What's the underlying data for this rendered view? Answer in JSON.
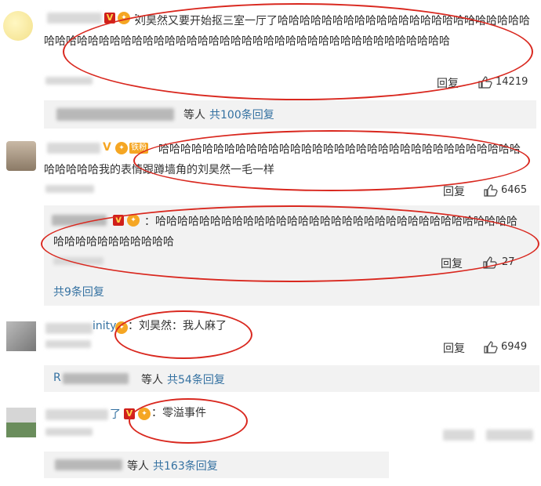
{
  "c1": {
    "colon": "：",
    "text": "刘昊然又要开始抠三室一厅了哈哈哈哈哈哈哈哈哈哈哈哈哈哈哈哈哈哈哈哈哈哈哈哈哈哈哈哈哈哈哈哈哈哈哈哈哈哈哈哈哈哈哈哈哈哈哈哈哈哈哈哈哈哈哈哈哈哈哈哈",
    "reply_label": "回复",
    "likes": "14219",
    "sub_prefix": "等人",
    "sub_count": "共100条回复"
  },
  "c2": {
    "fan_tag": "铁粉",
    "text": "哈哈哈哈哈哈哈哈哈哈哈哈哈哈哈哈哈哈哈哈哈哈哈哈哈哈哈哈哈哈哈哈哈哈哈哈哈哈我的表情跟蹲墙角的刘昊然一毛一样",
    "reply_label": "回复",
    "likes": "6465",
    "reply": {
      "text": "：哈哈哈哈哈哈哈哈哈哈哈哈哈哈哈哈哈哈哈哈哈哈哈哈哈哈哈哈哈哈哈哈哈哈哈哈哈哈哈哈哈哈哈哈",
      "reply_label": "回复",
      "likes": "27"
    },
    "more_replies": "共9条回复"
  },
  "c3": {
    "name_tail": "inity",
    "text": "：刘昊然：我人麻了",
    "reply_label": "回复",
    "likes": "6949",
    "sub_initial": "R",
    "sub_prefix": "等人",
    "sub_count": "共54条回复"
  },
  "c4": {
    "name_tail": "了",
    "text": "：零溢事件",
    "sub_prefix": "等人",
    "sub_count": "共163条回复"
  },
  "colors": {
    "annotation": "#d9281f",
    "link": "#3471a1",
    "reply_bg": "#f2f2f2"
  }
}
